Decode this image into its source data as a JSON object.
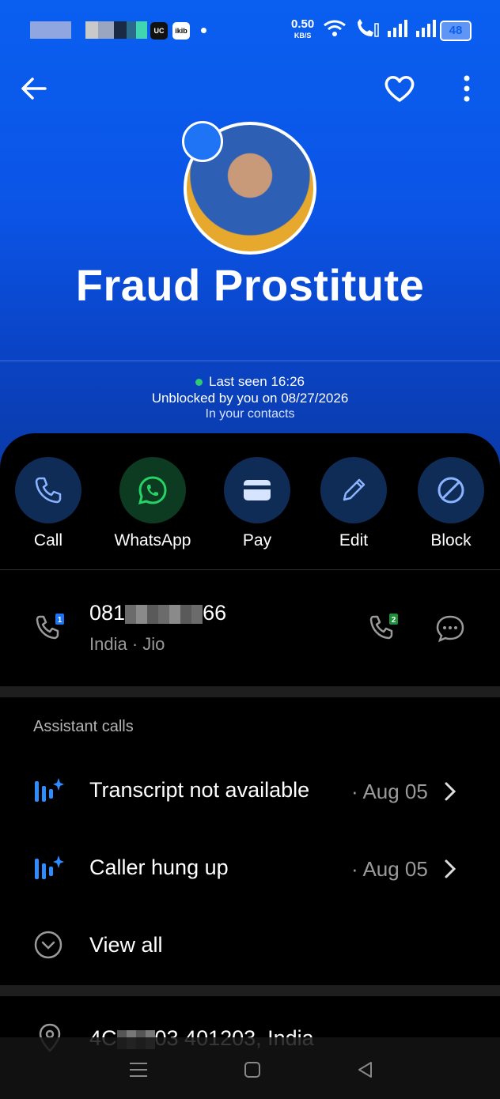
{
  "status_bar": {
    "app_badge_1": "UC",
    "app_badge_2": "ikib",
    "speed_value": "0.50",
    "speed_unit": "KB/S",
    "battery": "48",
    "icons": [
      "wifi-icon",
      "wifi-call-icon",
      "signal-icon",
      "signal-icon"
    ]
  },
  "header": {
    "back_icon": "arrow-left-icon",
    "favorite_icon": "heart-icon",
    "more_icon": "more-vertical-icon",
    "contact_name": "Fraud Prostitute",
    "last_seen": "Last seen 16:26",
    "unblocked": "Unblocked by you on 08/27/2026",
    "in_contacts": "In your contacts"
  },
  "actions": [
    {
      "label": "Call",
      "icon": "phone-icon"
    },
    {
      "label": "WhatsApp",
      "icon": "whatsapp-icon"
    },
    {
      "label": "Pay",
      "icon": "wallet-icon"
    },
    {
      "label": "Edit",
      "icon": "pencil-icon"
    },
    {
      "label": "Block",
      "icon": "block-icon"
    }
  ],
  "phone": {
    "number_prefix": "081",
    "number_suffix": "66",
    "sim1_badge": "1",
    "sim2_badge": "2",
    "country": "India",
    "separator": "·",
    "carrier": "Jio"
  },
  "assistant_calls": {
    "title": "Assistant calls",
    "items": [
      {
        "text": "Transcript not available",
        "date": "· Aug 05"
      },
      {
        "text": "Caller hung up",
        "date": "· Aug 05"
      }
    ],
    "view_all": "View all"
  },
  "address": {
    "prefix": "4C",
    "suffix": "03 401203, India"
  },
  "colors": {
    "accent": "#0a5ff0",
    "action_circle": "#0f2c57",
    "whatsapp_circle": "#0d3b22",
    "whatsapp_green": "#25d366",
    "icon_blue": "#2f8cff"
  }
}
